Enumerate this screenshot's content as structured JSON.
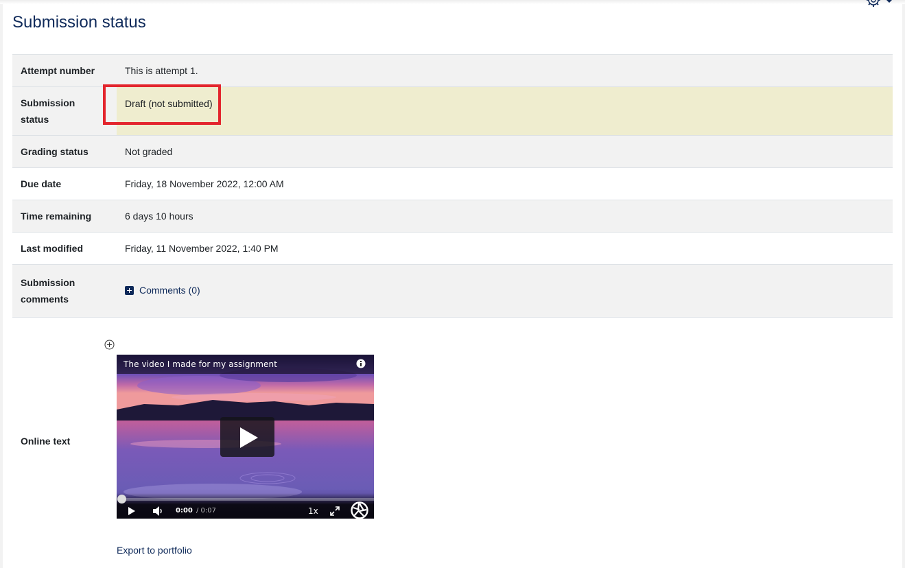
{
  "page": {
    "title": "Submission status",
    "settings_icon": "gear-icon"
  },
  "rows": {
    "attempt": {
      "label": "Attempt number",
      "value": "This is attempt 1."
    },
    "submission_status": {
      "label_line1": "Submission",
      "label_line2": "status",
      "value": "Draft (not submitted)"
    },
    "grading": {
      "label": "Grading status",
      "value": "Not graded"
    },
    "due": {
      "label": "Due date",
      "value": "Friday, 18 November 2022, 12:00 AM"
    },
    "remaining": {
      "label": "Time remaining",
      "value": "6 days 10 hours"
    },
    "modified": {
      "label": "Last modified",
      "value": "Friday, 11 November 2022, 1:40 PM"
    },
    "comments": {
      "label_line1": "Submission",
      "label_line2": "comments",
      "link": "Comments (0)"
    },
    "online": {
      "label": "Online text"
    }
  },
  "video": {
    "title": "The video I made for my assignment",
    "current_time": "0:00",
    "duration": "/ 0:07",
    "speed": "1x",
    "progress": 0
  },
  "export_link": "Export to portfolio",
  "colors": {
    "heading": "#0f2a5a",
    "highlight_border": "#e3252d",
    "draft_row": "#efedcf",
    "grey_row": "#f2f2f2"
  }
}
